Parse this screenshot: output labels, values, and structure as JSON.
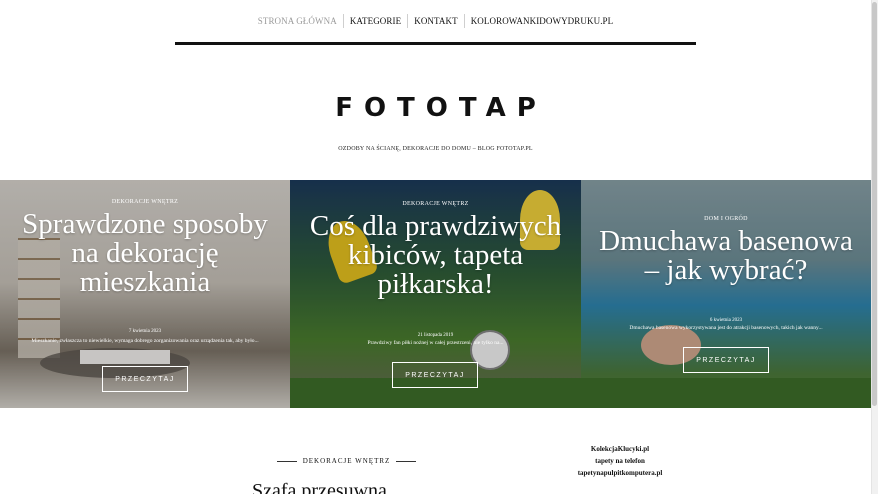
{
  "nav": {
    "items": [
      {
        "label": "STRONA GŁÓWNA",
        "active": true
      },
      {
        "label": "KATEGORIE",
        "active": false
      },
      {
        "label": "KONTAKT",
        "active": false
      },
      {
        "label": "KOLOROWANKIDOWYDRUKU.PL",
        "active": false
      }
    ]
  },
  "brand": {
    "title": "FOTOTAP",
    "tagline": "OZDOBY NA ŚCIANĘ, DEKORACJE DO DOMU – BLOG FOTOTAP.PL"
  },
  "hero": {
    "cards": [
      {
        "category": "DEKORACJE WNĘTRZ",
        "title": "Sprawdzone sposoby na dekorację mieszkania",
        "date": "7 kwietnia 2023",
        "excerpt": "Mieszkanie, zwłaszcza to niewielkie, wymaga dobrego zorganizowania oraz urządzenia tak, aby było...",
        "button": "PRZECZYTAJ"
      },
      {
        "category": "DEKORACJE WNĘTRZ",
        "title": "Coś dla prawdziwych kibiców, tapeta piłkarska!",
        "date": "21 listopada 2019",
        "excerpt": "Prawdziwy fan piłki nożnej w całej przestrzeni, nie tylko na...",
        "button": "PRZECZYTAJ"
      },
      {
        "category": "DOM I OGRÓD",
        "title": "Dmuchawa basenowa – jak wybrać?",
        "date": "6 kwietnia 2023",
        "excerpt": "Dmuchawa basenowa wykorzystywana jest do atrakcji basenowych, takich jak wanny...",
        "button": "PRZECZYTAJ"
      }
    ]
  },
  "section": {
    "label": "DEKORACJE WNĘTRZ",
    "post_title": "Szafa przesuwna"
  },
  "sidebar": {
    "links": [
      "KolekcjaKlucyki.pl",
      "tapety na telefon",
      "tapetynapulpitkomputera.pl"
    ]
  }
}
